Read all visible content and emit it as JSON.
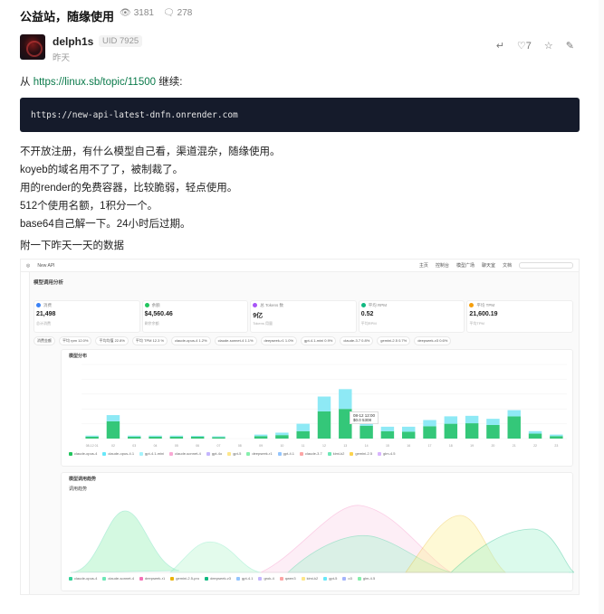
{
  "topic": {
    "title": "公益站，随缘使用",
    "views": "3181",
    "replies": "278"
  },
  "post": {
    "author": "delph1s",
    "uid": "UID 7925",
    "date": "昨天",
    "likes": "7",
    "from_prefix": "从",
    "link": "https://linux.sb/topic/11500",
    "from_suffix": "继续:",
    "code": "https://new-api-latest-dnfn.onrender.com",
    "lines": [
      "不开放注册，有什么模型自己看，渠道混杂，随缘使用。",
      "koyeb的域名用不了了，被制裁了。",
      "用的render的免费容器，比较脆弱，轻点使用。",
      "512个使用名额，1积分一个。",
      "base64自己解一下。24小时后过期。"
    ],
    "attach_label": "附一下昨天一天的数据"
  },
  "shot": {
    "app_name": "New API",
    "nav": [
      "主页",
      "控制台",
      "模型广场",
      "聊天室",
      "文档"
    ],
    "section_title": "模型调用分析",
    "cards": [
      {
        "label": "消费",
        "value": "21,498",
        "sub": "总计消费",
        "color": "#3b82f6"
      },
      {
        "label": "余额",
        "value": "$4,560.46",
        "sub": "剩余余额",
        "color": "#22c55e"
      },
      {
        "label": "总 Tokens 数",
        "value": "9亿",
        "sub": "Tokens 用量",
        "color": "#a855f7"
      },
      {
        "label": "平均 RPM",
        "value": "0.52",
        "sub": "平均RPM",
        "color": "#10b981"
      },
      {
        "label": "平均 TPM",
        "value": "21,600.19",
        "sub": "平均TPM",
        "color": "#f59e0b"
      }
    ],
    "chips": [
      "消费金额",
      "平均 rpm 12.0%",
      "平均均值 22.8%",
      "平均 TPM 12.3 %",
      "claude-opus-4 1.2%",
      "claude-sonnet-4 1.1%",
      "deepseek-r1 1.0%",
      "gpt-4.1-mini 0.9%",
      "claude-3.7 0.8%",
      "gemini-2.5 0.7%",
      "deepseek-v3 0.6%"
    ],
    "chart1_title": "模型分布",
    "chart2_title": "模型调用趋势",
    "chart2_sub": "调用趋势",
    "tooltip": "08-12 12:00",
    "tooltip_value": "$0.0 5308",
    "legend1": [
      "claude-opus-4",
      "claude-opus-4.1",
      "gpt-4.1-mini",
      "claude-sonnet-4",
      "gpt-4o",
      "gpt-5",
      "deepseek-r1",
      "gpt-4.1",
      "claude-3.7",
      "kimi-k2",
      "gemini-2.5",
      "glm-4.5"
    ],
    "legend2": [
      "claude-opus-4",
      "claude-sonnet-4",
      "deepseek-r1",
      "gemini-2.5-pro",
      "deepseek-v3",
      "gpt-4.1",
      "grok-4",
      "qwen3",
      "kimi-k2",
      "gpt-5",
      "o3",
      "glm-4.5"
    ]
  },
  "chart_data": [
    {
      "type": "bar",
      "categories": [
        "08-12 01",
        "02",
        "03",
        "04",
        "05",
        "06",
        "07",
        "08",
        "09",
        "10",
        "11",
        "12",
        "13",
        "14",
        "15",
        "16",
        "17",
        "18",
        "19",
        "20",
        "21",
        "22",
        "23"
      ],
      "series": [
        {
          "values": [
            8,
            70,
            8,
            8,
            8,
            8,
            6,
            0,
            10,
            14,
            30,
            110,
            120,
            52,
            30,
            28,
            50,
            60,
            62,
            55,
            90,
            20,
            10
          ]
        },
        {
          "values": [
            4,
            25,
            4,
            4,
            4,
            3,
            3,
            0,
            6,
            10,
            30,
            60,
            80,
            30,
            18,
            20,
            25,
            30,
            30,
            25,
            25,
            10,
            6
          ]
        }
      ],
      "ylim": [
        0,
        300
      ]
    }
  ]
}
